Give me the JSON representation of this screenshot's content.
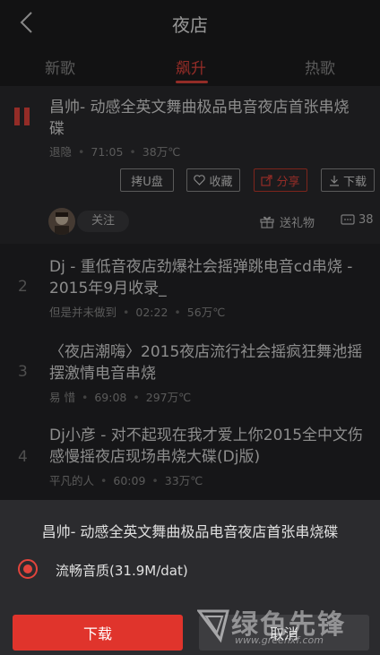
{
  "header": {
    "title": "夜店"
  },
  "tabs": [
    {
      "label": "新歌"
    },
    {
      "label": "飙升"
    },
    {
      "label": "热歌"
    }
  ],
  "songs": [
    {
      "index": "",
      "title_line1": "昌帅- 动感全英文舞曲极品电音夜店首张串烧",
      "title_line2": "碟",
      "artist": "退隐",
      "duration": "71:05",
      "plays": "38万℃"
    },
    {
      "index": "2",
      "title_line1": "Dj - 重低音夜店劲爆社会摇弹跳电音cd串烧 -",
      "title_line2": "2015年9月收录_",
      "artist": "但是并未做到",
      "duration": "02:22",
      "plays": "56万℃"
    },
    {
      "index": "3",
      "title_line1": "〈夜店潮嗨〉2015夜店流行社会摇疯狂舞池摇",
      "title_line2": "摆激情电音串烧",
      "artist": "易  惜",
      "duration": "69:08",
      "plays": "297万℃"
    },
    {
      "index": "4",
      "title_line1": "Dj小彦 - 对不起现在我才爱上你2015全中文伤",
      "title_line2": "感慢摇夜店现场串烧大碟(Dj版)",
      "artist": "平凡的人",
      "duration": "60:09",
      "plays": "33万℃"
    }
  ],
  "actions": {
    "usb": "拷U盘",
    "favorite": "收藏",
    "share": "分享",
    "download": "下载",
    "follow": "关注",
    "gift": "送礼物",
    "comments": "38"
  },
  "sheet": {
    "title": "昌帅- 动感全英文舞曲极品电音夜店首张串烧碟",
    "quality": "流畅音质(31.9M/dat)",
    "download_button": "下载",
    "cancel_button": "取消"
  },
  "watermark": {
    "text": "绿色先锋",
    "url": "www.greenxf.com"
  },
  "colors": {
    "accent": "#e2443c",
    "background": "#1e1e1f"
  }
}
